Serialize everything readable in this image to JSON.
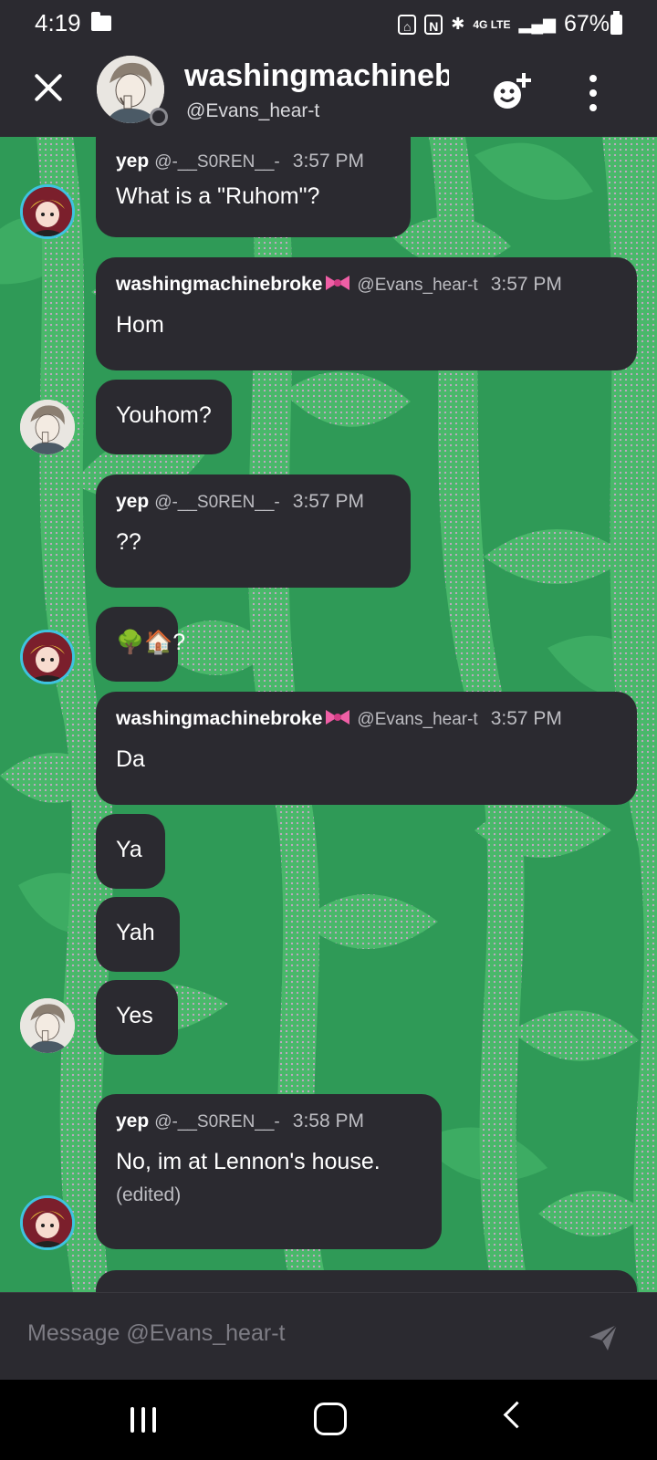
{
  "status_bar": {
    "time": "4:19",
    "network": "4G LTE",
    "battery": "67%"
  },
  "header": {
    "title": "washingmachinebroke",
    "handle": "@Evans_hear-t"
  },
  "messages": [
    {
      "author": "yep",
      "handle": "@-__S0REN__-",
      "time": "3:57 PM",
      "text": "What is a \"Ruhom\"?"
    },
    {
      "author": "washingmachinebroke",
      "handle": "@Evans_hear-t",
      "time": "3:57 PM",
      "text": "Hom"
    },
    {
      "text": "Youhom?"
    },
    {
      "author": "yep",
      "handle": "@-__S0REN__-",
      "time": "3:57 PM",
      "text": "??"
    },
    {
      "text": "🌳🏠?"
    },
    {
      "author": "washingmachinebroke",
      "handle": "@Evans_hear-t",
      "time": "3:57 PM",
      "text": "Da"
    },
    {
      "text": "Ya"
    },
    {
      "text": "Yah"
    },
    {
      "text": "Yes"
    },
    {
      "author": "yep",
      "handle": "@-__S0REN__-",
      "time": "3:58 PM",
      "text": "No, im at Lennon's house.",
      "edited": "(edited)"
    }
  ],
  "composer": {
    "placeholder": "Message @Evans_hear-t"
  },
  "colors": {
    "panel": "#2b2a30",
    "background_green": "#2f9a57",
    "leaf_green": "#49b86a",
    "avatar_ring": "#3ec3e0"
  }
}
